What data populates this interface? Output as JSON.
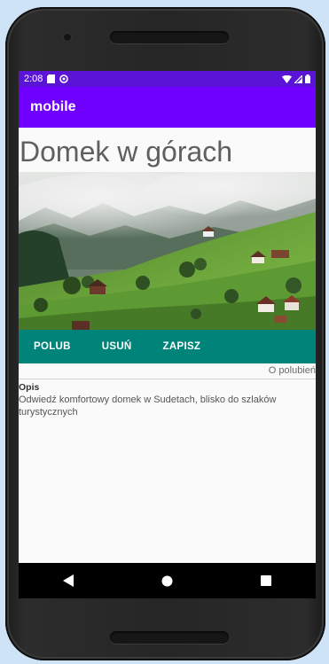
{
  "status_bar": {
    "time": "2:08",
    "icons": [
      "sd-card-icon",
      "sync-icon",
      "wifi-icon",
      "signal-icon",
      "battery-icon"
    ]
  },
  "app_bar": {
    "title": "mobile"
  },
  "listing": {
    "title": "Domek w górach",
    "image": {
      "description_icon": "mountain-landscape-photo"
    },
    "actions": {
      "like": "POLUB",
      "delete": "USUŃ",
      "save": "ZAPISZ"
    },
    "likes_text": "O polubień",
    "description_label": "Opis",
    "description": "Odwiedź komfortowy domek w Sudetach, blisko do szlaków turystycznych"
  },
  "nav_bar": {
    "icons": [
      "back-icon",
      "home-icon",
      "recents-icon"
    ]
  },
  "colors": {
    "status_bar": "#5a14d6",
    "app_bar": "#6f00ff",
    "action_bar": "#00847a",
    "screen_bg": "#fafafa"
  }
}
